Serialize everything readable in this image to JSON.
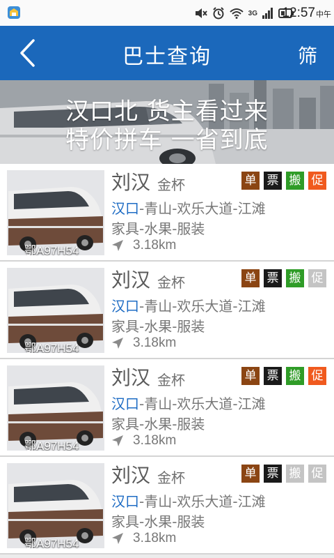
{
  "status_bar": {
    "time": "12:57",
    "period": "中午",
    "network": "3G"
  },
  "header": {
    "title": "巴士查询",
    "filter_label": "筛"
  },
  "banner": {
    "line1": "汉口北  货主看过来",
    "line2": "特价拼车  一省到底"
  },
  "listings": [
    {
      "name": "刘汉",
      "brand": "金杯",
      "plate": "鄂A97H54",
      "route_start": "汉口",
      "route_rest": "-青山-欢乐大道-江滩",
      "goods": "家具-水果-服装",
      "distance": "3.18km",
      "badges": [
        {
          "label": "单",
          "active": true,
          "color": "#8b4513"
        },
        {
          "label": "票",
          "active": true,
          "color": "#1a1a1a"
        },
        {
          "label": "搬",
          "active": true,
          "color": "#2f9c27"
        },
        {
          "label": "促",
          "active": true,
          "color": "#f05a1e"
        }
      ]
    },
    {
      "name": "刘汉",
      "brand": "金杯",
      "plate": "鄂A97H54",
      "route_start": "汉口",
      "route_rest": "-青山-欢乐大道-江滩",
      "goods": "家具-水果-服装",
      "distance": "3.18km",
      "badges": [
        {
          "label": "单",
          "active": true,
          "color": "#8b4513"
        },
        {
          "label": "票",
          "active": true,
          "color": "#1a1a1a"
        },
        {
          "label": "搬",
          "active": true,
          "color": "#2f9c27"
        },
        {
          "label": "促",
          "active": false,
          "color": "#c4c4c4"
        }
      ]
    },
    {
      "name": "刘汉",
      "brand": "金杯",
      "plate": "鄂A97H54",
      "route_start": "汉口",
      "route_rest": "-青山-欢乐大道-江滩",
      "goods": "家具-水果-服装",
      "distance": "3.18km",
      "badges": [
        {
          "label": "单",
          "active": true,
          "color": "#8b4513"
        },
        {
          "label": "票",
          "active": true,
          "color": "#1a1a1a"
        },
        {
          "label": "搬",
          "active": true,
          "color": "#2f9c27"
        },
        {
          "label": "促",
          "active": true,
          "color": "#f05a1e"
        }
      ]
    },
    {
      "name": "刘汉",
      "brand": "金杯",
      "plate": "鄂A97H54",
      "route_start": "汉口",
      "route_rest": "-青山-欢乐大道-江滩",
      "goods": "家具-水果-服装",
      "distance": "3.18km",
      "badges": [
        {
          "label": "单",
          "active": true,
          "color": "#8b4513"
        },
        {
          "label": "票",
          "active": true,
          "color": "#1a1a1a"
        },
        {
          "label": "搬",
          "active": false,
          "color": "#c4c4c4"
        },
        {
          "label": "促",
          "active": false,
          "color": "#c4c4c4"
        }
      ]
    }
  ],
  "icons": {
    "back": "back-chevron-icon",
    "location": "location-arrow-icon"
  }
}
